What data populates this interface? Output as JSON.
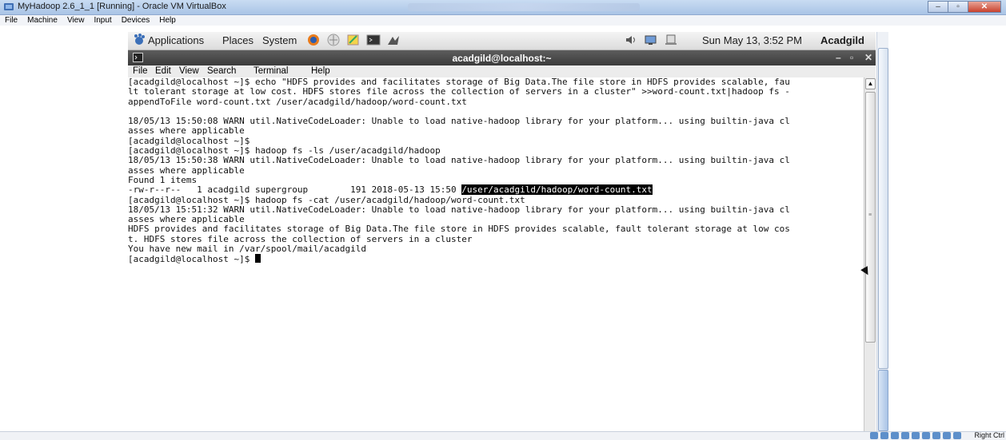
{
  "vbox": {
    "title": "MyHadoop 2.6_1_1 [Running] - Oracle VM VirtualBox",
    "menu": [
      "File",
      "Machine",
      "View",
      "Input",
      "Devices",
      "Help"
    ],
    "status_right": "Right Ctrl"
  },
  "gnome_panel": {
    "applications": "Applications",
    "places": "Places",
    "system": "System",
    "clock": "Sun May 13,  3:52 PM",
    "user": "Acadgild"
  },
  "terminal": {
    "title": "acadgild@localhost:~",
    "menu": {
      "file": "File",
      "edit": "Edit",
      "view": "View",
      "search": "Search",
      "terminal": "Terminal",
      "help": "Help"
    },
    "lines": {
      "l1": "[acadgild@localhost ~]$ echo \"HDFS provides and facilitates storage of Big Data.The file store in HDFS provides scalable, fau",
      "l2": "lt tolerant storage at low cost. HDFS stores file across the collection of servers in a cluster\" >>word-count.txt|hadoop fs -",
      "l3": "appendToFile word-count.txt /user/acadgild/hadoop/word-count.txt",
      "l4": "",
      "l5": "18/05/13 15:50:08 WARN util.NativeCodeLoader: Unable to load native-hadoop library for your platform... using builtin-java cl",
      "l6": "asses where applicable",
      "l7": "[acadgild@localhost ~]$",
      "l8": "[acadgild@localhost ~]$ hadoop fs -ls /user/acadgild/hadoop",
      "l9": "18/05/13 15:50:38 WARN util.NativeCodeLoader: Unable to load native-hadoop library for your platform... using builtin-java cl",
      "l10": "asses where applicable",
      "l11": "Found 1 items",
      "l12a": "-rw-r--r--   1 acadgild supergroup        191 2018-05-13 15:50 ",
      "l12b": "/user/acadgild/hadoop/word-count.txt",
      "l13": "[acadgild@localhost ~]$ hadoop fs -cat /user/acadgild/hadoop/word-count.txt",
      "l14": "18/05/13 15:51:32 WARN util.NativeCodeLoader: Unable to load native-hadoop library for your platform... using builtin-java cl",
      "l15": "asses where applicable",
      "l16": "HDFS provides and facilitates storage of Big Data.The file store in HDFS provides scalable, fault tolerant storage at low cos",
      "l17": "t. HDFS stores file across the collection of servers in a cluster",
      "l18": "You have new mail in /var/spool/mail/acadgild",
      "l19": "[acadgild@localhost ~]$ "
    }
  },
  "icons": {
    "vbox_app": "virtualbox-icon",
    "firefox": "firefox-icon",
    "network": "network-icon",
    "notes": "notes-icon",
    "terminal": "terminal-icon",
    "eclipse": "eclipse-icon",
    "volume": "volume-icon",
    "display": "display-icon"
  },
  "colors": {
    "terminal_title_bg": "#4a4a4a",
    "selection_bg": "#000000",
    "vbox_title_bg": "#b8cfee"
  }
}
